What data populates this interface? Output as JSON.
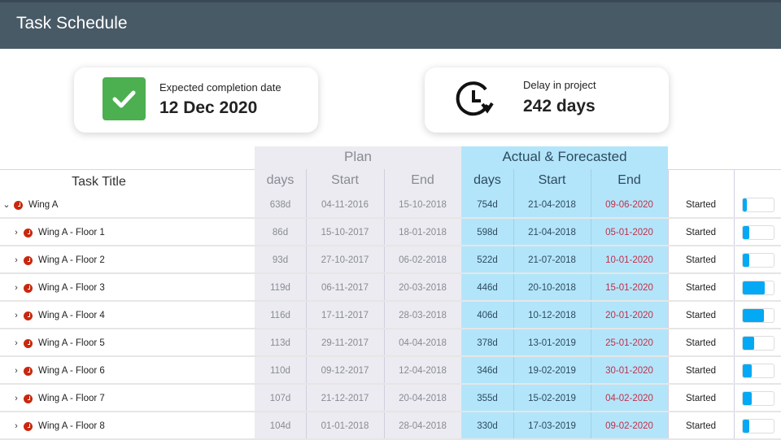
{
  "header": {
    "title": "Task Schedule"
  },
  "cards": {
    "completion": {
      "label": "Expected completion date",
      "value": "12 Dec 2020",
      "icon": "check-icon",
      "color": "#4caf50"
    },
    "delay": {
      "label": "Delay in project",
      "value": "242 days",
      "icon": "clock-refresh-icon"
    }
  },
  "table": {
    "groups": {
      "plan": "Plan",
      "actual": "Actual & Forecasted"
    },
    "columns": {
      "title": "Task Title",
      "plan_days": "days",
      "plan_start": "Start",
      "plan_end": "End",
      "act_days": "days",
      "act_start": "Start",
      "act_end": "End"
    },
    "rows": [
      {
        "title": "Wing A",
        "expanded": true,
        "plan_days": "638d",
        "plan_start": "04-11-2016",
        "plan_end": "15-10-2018",
        "act_days": "754d",
        "act_start": "21-04-2018",
        "act_end": "09-06-2020",
        "status": "Started",
        "progress": 0.14
      },
      {
        "title": "Wing A - Floor 1",
        "plan_days": "86d",
        "plan_start": "15-10-2017",
        "plan_end": "18-01-2018",
        "act_days": "598d",
        "act_start": "21-04-2018",
        "act_end": "05-01-2020",
        "status": "Started",
        "progress": 0.22
      },
      {
        "title": "Wing A - Floor 2",
        "plan_days": "93d",
        "plan_start": "27-10-2017",
        "plan_end": "06-02-2018",
        "act_days": "522d",
        "act_start": "21-07-2018",
        "act_end": "10-01-2020",
        "status": "Started",
        "progress": 0.22
      },
      {
        "title": "Wing A - Floor 3",
        "plan_days": "119d",
        "plan_start": "06-11-2017",
        "plan_end": "20-03-2018",
        "act_days": "446d",
        "act_start": "20-10-2018",
        "act_end": "15-01-2020",
        "status": "Started",
        "progress": 0.72
      },
      {
        "title": "Wing A - Floor 4",
        "plan_days": "116d",
        "plan_start": "17-11-2017",
        "plan_end": "28-03-2018",
        "act_days": "406d",
        "act_start": "10-12-2018",
        "act_end": "20-01-2020",
        "status": "Started",
        "progress": 0.69
      },
      {
        "title": "Wing A - Floor 5",
        "plan_days": "113d",
        "plan_start": "29-11-2017",
        "plan_end": "04-04-2018",
        "act_days": "378d",
        "act_start": "13-01-2019",
        "act_end": "25-01-2020",
        "status": "Started",
        "progress": 0.36
      },
      {
        "title": "Wing A - Floor 6",
        "plan_days": "110d",
        "plan_start": "09-12-2017",
        "plan_end": "12-04-2018",
        "act_days": "346d",
        "act_start": "19-02-2019",
        "act_end": "30-01-2020",
        "status": "Started",
        "progress": 0.29
      },
      {
        "title": "Wing A - Floor 7",
        "plan_days": "107d",
        "plan_start": "21-12-2017",
        "plan_end": "20-04-2018",
        "act_days": "355d",
        "act_start": "15-02-2019",
        "act_end": "04-02-2020",
        "status": "Started",
        "progress": 0.29
      },
      {
        "title": "Wing A - Floor 8",
        "plan_days": "104d",
        "plan_start": "01-01-2018",
        "plan_end": "28-04-2018",
        "act_days": "330d",
        "act_start": "17-03-2019",
        "act_end": "09-02-2020",
        "status": "Started",
        "progress": 0.22
      }
    ],
    "colors": {
      "late_end": "#c0304a",
      "progress": "#03a9f4",
      "actual_bg": "#b3e5fa",
      "plan_bg": "#ebebf1"
    }
  }
}
